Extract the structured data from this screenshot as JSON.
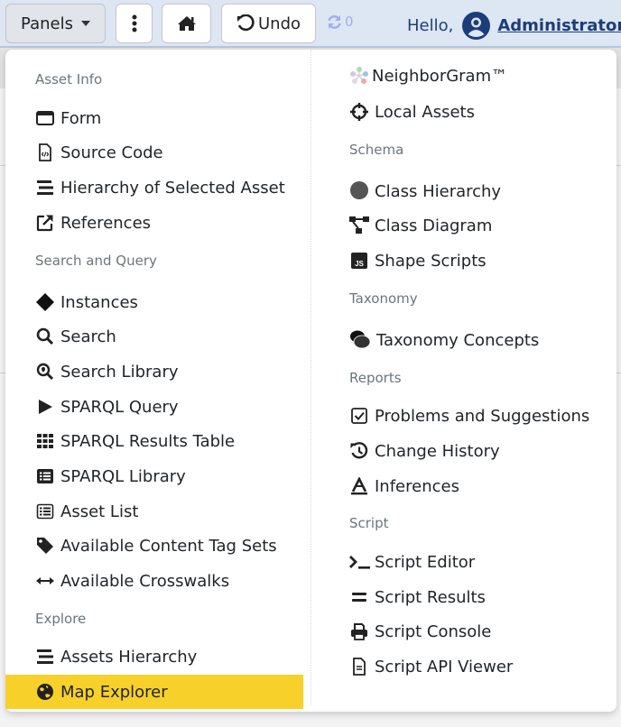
{
  "toolbar": {
    "panels_label": "Panels",
    "undo_label": "Undo",
    "redo_count": "0",
    "greeting": "Hello,",
    "username": "Administrator"
  },
  "colors": {
    "topbar_bg": "#dde6f3",
    "active_item_bg": "#f8d02a",
    "header_text": "#6c757d",
    "user_link": "#1c3d7a",
    "redo_icon": "#a3aef0"
  },
  "menu": {
    "left": {
      "sections": [
        {
          "header": "Asset Info",
          "items": [
            {
              "label": "Form",
              "icon": "window-icon"
            },
            {
              "label": "Source Code",
              "icon": "file-code-icon"
            },
            {
              "label": "Hierarchy of Selected Asset",
              "icon": "hierarchy-bars-icon"
            },
            {
              "label": "References",
              "icon": "external-link-icon"
            }
          ]
        },
        {
          "header": "Search and Query",
          "items": [
            {
              "label": "Instances",
              "icon": "diamond-icon"
            },
            {
              "label": "Search",
              "icon": "search-icon"
            },
            {
              "label": "Search Library",
              "icon": "search-location-icon"
            },
            {
              "label": "SPARQL Query",
              "icon": "play-icon"
            },
            {
              "label": "SPARQL Results Table",
              "icon": "grid-icon"
            },
            {
              "label": "SPARQL Library",
              "icon": "list-alt-icon"
            },
            {
              "label": "Asset List",
              "icon": "list-outline-icon"
            },
            {
              "label": "Available Content Tag Sets",
              "icon": "tag-icon"
            },
            {
              "label": "Available Crosswalks",
              "icon": "arrows-horizontal-icon"
            }
          ]
        },
        {
          "header": "Explore",
          "items": [
            {
              "label": "Assets Hierarchy",
              "icon": "hierarchy-bars-icon"
            },
            {
              "label": "Map Explorer",
              "icon": "globe-icon",
              "active": true
            }
          ]
        }
      ]
    },
    "right": {
      "sections": [
        {
          "header": "",
          "items": [
            {
              "label": "NeighborGram™",
              "icon": "neighborgram-icon"
            },
            {
              "label": "Local Assets",
              "icon": "crosshairs-icon"
            }
          ]
        },
        {
          "header": "Schema",
          "items": [
            {
              "label": "Class Hierarchy",
              "icon": "circle-icon"
            },
            {
              "label": "Class Diagram",
              "icon": "diagram-icon"
            },
            {
              "label": "Shape Scripts",
              "icon": "js-icon"
            }
          ]
        },
        {
          "header": "Taxonomy",
          "items": [
            {
              "label": "Taxonomy Concepts",
              "icon": "concepts-icon"
            }
          ]
        },
        {
          "header": "Reports",
          "items": [
            {
              "label": "Problems and Suggestions",
              "icon": "check-square-icon"
            },
            {
              "label": "Change History",
              "icon": "history-icon"
            },
            {
              "label": "Inferences",
              "icon": "inference-icon"
            }
          ]
        },
        {
          "header": "Script",
          "items": [
            {
              "label": "Script Editor",
              "icon": "terminal-icon"
            },
            {
              "label": "Script Results",
              "icon": "equals-icon"
            },
            {
              "label": "Script Console",
              "icon": "print-icon"
            },
            {
              "label": "Script API Viewer",
              "icon": "file-text-icon"
            }
          ]
        }
      ]
    }
  }
}
